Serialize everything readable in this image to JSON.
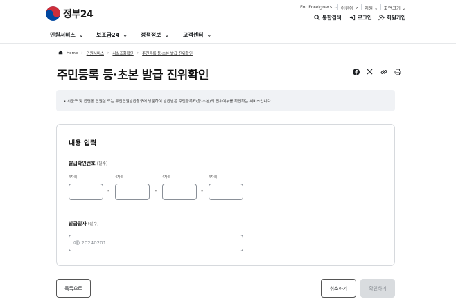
{
  "header": {
    "logo_text": "정부24",
    "util_links": [
      "For Foreigners",
      "어린이",
      "지원",
      "화면크기"
    ],
    "search_label": "통합검색",
    "login_label": "로그인",
    "signup_label": "회원가입"
  },
  "gnb": {
    "items": [
      "민원서비스",
      "보조금24",
      "정책정보",
      "고객센터"
    ]
  },
  "breadcrumb": {
    "home": "Home",
    "items": [
      "민원서비스",
      "사실조회확인",
      "주민등록 등·초본 발급 진위확인"
    ]
  },
  "page": {
    "title": "주민등록 등·초본 발급 진위확인",
    "notice": "• 시군구 및 읍면동 민원실 또는 무인민원발급창구에 방문하여 발급받은 주민등록표(등·초본)의 진위여부를 확인하는 서비스입니다."
  },
  "form": {
    "section_title": "내용 입력",
    "code_label": "발급확인번호",
    "code_required": "(필수)",
    "code_sub_label": "4자리",
    "date_label": "발급일자",
    "date_required": "(필수)",
    "date_placeholder": "예) 20240201"
  },
  "buttons": {
    "list": "목록으로",
    "cancel": "취소하기",
    "confirm": "확인하기"
  },
  "colors": {
    "logo_red": "#cd2e3a",
    "logo_blue": "#0047a0",
    "notice_bg": "#f0f2f5",
    "disabled_bg": "#d9dcdf"
  }
}
